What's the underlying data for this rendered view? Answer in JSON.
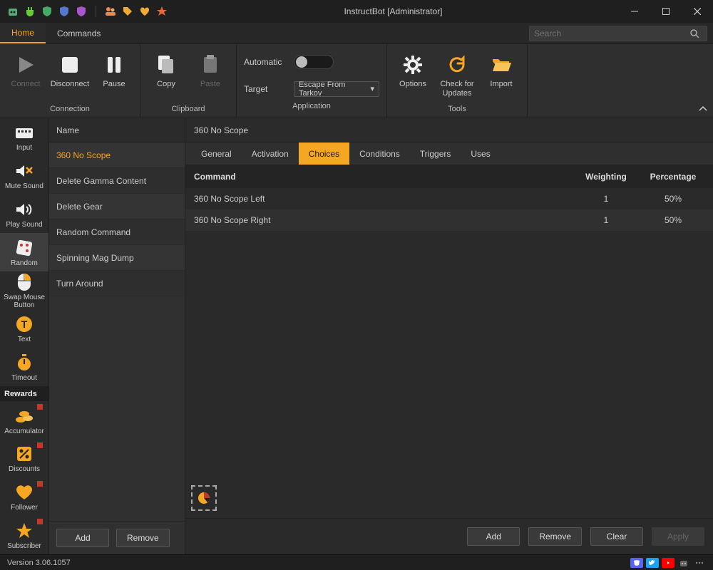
{
  "window": {
    "title": "InstructBot [Administrator]"
  },
  "tabs": {
    "home": "Home",
    "commands": "Commands",
    "search_placeholder": "Search"
  },
  "ribbon": {
    "connection": {
      "label": "Connection",
      "connect": "Connect",
      "disconnect": "Disconnect",
      "pause": "Pause"
    },
    "clipboard": {
      "label": "Clipboard",
      "copy": "Copy",
      "paste": "Paste"
    },
    "application": {
      "label": "Application",
      "automatic": "Automatic",
      "target": "Target",
      "target_value": "Escape From Tarkov"
    },
    "tools": {
      "label": "Tools",
      "options": "Options",
      "check_updates": "Check for Updates",
      "import": "Import"
    }
  },
  "leftnav": {
    "input": "Input",
    "mute_sound": "Mute Sound",
    "play_sound": "Play Sound",
    "random": "Random",
    "swap_mouse": "Swap Mouse Button",
    "text": "Text",
    "timeout": "Timeout",
    "rewards_header": "Rewards",
    "accumulator": "Accumulator",
    "discounts": "Discounts",
    "follower": "Follower",
    "subscriber": "Subscriber"
  },
  "commands": {
    "header": "Name",
    "items": [
      "360 No Scope",
      "Delete Gamma Content",
      "Delete Gear",
      "Random Command",
      "Spinning Mag Dump",
      "Turn Around"
    ],
    "selected": "360 No Scope",
    "add": "Add",
    "remove": "Remove"
  },
  "detail": {
    "title": "360 No Scope",
    "subtabs": {
      "general": "General",
      "activation": "Activation",
      "choices": "Choices",
      "conditions": "Conditions",
      "triggers": "Triggers",
      "uses": "Uses"
    },
    "columns": {
      "command": "Command",
      "weighting": "Weighting",
      "percentage": "Percentage"
    },
    "rows": [
      {
        "command": "360 No Scope Left",
        "weighting": "1",
        "percentage": "50%"
      },
      {
        "command": "360 No Scope Right",
        "weighting": "1",
        "percentage": "50%"
      }
    ],
    "add": "Add",
    "remove": "Remove",
    "clear": "Clear",
    "apply": "Apply"
  },
  "statusbar": {
    "version": "Version 3.06.1057"
  }
}
